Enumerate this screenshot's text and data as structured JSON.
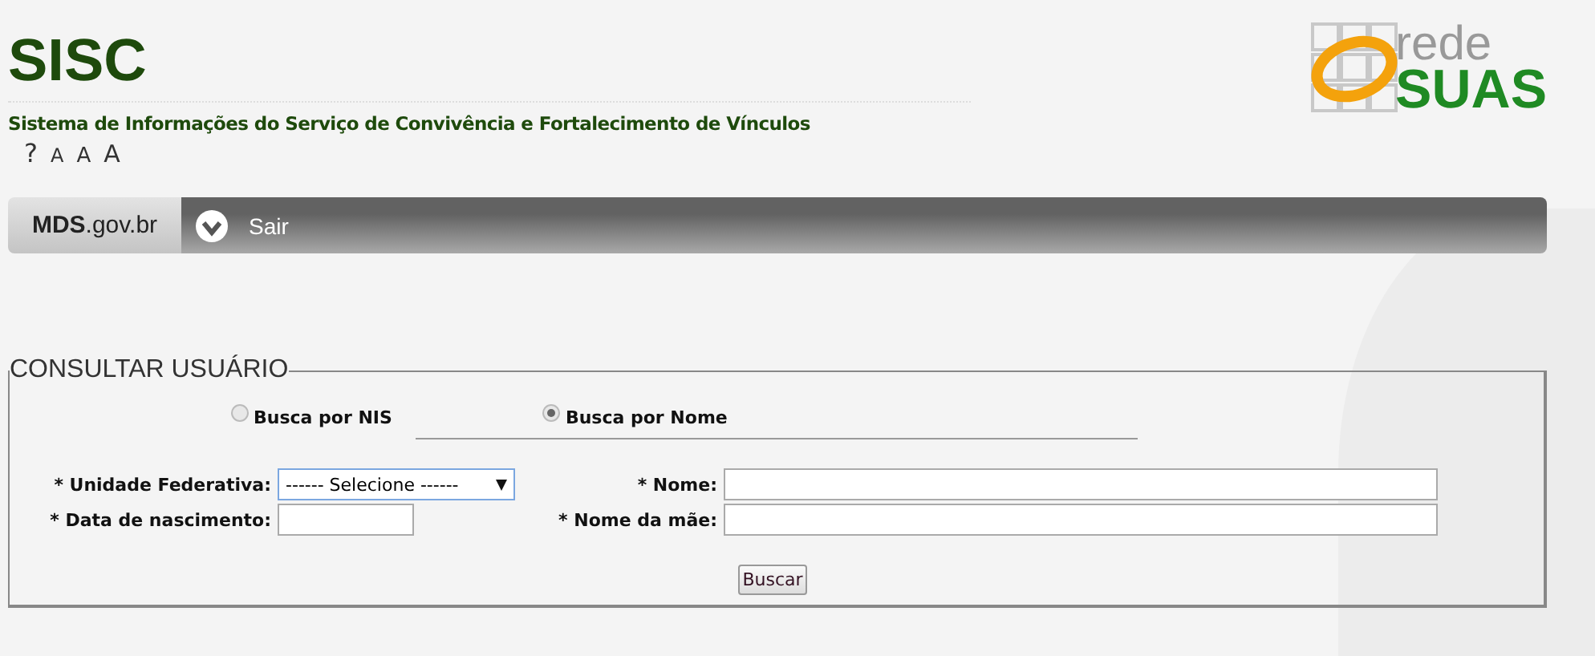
{
  "header": {
    "title": "SISC",
    "subtitle": "Sistema de Informações do Serviço de Convivência e Fortalecimento de Vínculos",
    "help": "?",
    "font_sizes": [
      "A",
      "A",
      "A"
    ],
    "logo": {
      "top": "rede",
      "bottom": "SUAS"
    }
  },
  "nav": {
    "brand": "**MDS**.gov.br",
    "items": [
      {
        "label": "Sair"
      }
    ]
  },
  "form": {
    "legend": "CONSULTAR USUÁRIO",
    "search_modes": [
      {
        "label": "Busca por NIS",
        "selected": false
      },
      {
        "label": "Busca por Nome",
        "selected": true
      }
    ],
    "fields": [
      {
        "label": "* Unidade Federativa:",
        "kind": "select",
        "value": "------ Selecione ------"
      },
      {
        "label": "* Nome:",
        "kind": "text"
      },
      {
        "label": "* Data de nascimento:",
        "kind": "short"
      },
      {
        "label": "* Nome da mãe:",
        "kind": "text"
      }
    ],
    "button": "Buscar"
  }
}
